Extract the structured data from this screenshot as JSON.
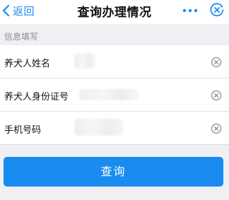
{
  "navbar": {
    "back_label": "返回",
    "title": "查询办理情况",
    "back_icon": "chevron-left-icon",
    "more_icon": "more-dots-icon",
    "close_icon": "close-circle-icon"
  },
  "section": {
    "header": "信息填写"
  },
  "form": {
    "fields": [
      {
        "label": "养犬人姓名",
        "value_state": "redacted",
        "clear_icon": "clear-icon"
      },
      {
        "label": "养犬人身份证号",
        "value_state": "redacted",
        "clear_icon": "clear-icon"
      },
      {
        "label": "手机号码",
        "value_state": "redacted",
        "clear_icon": "clear-icon"
      }
    ]
  },
  "submit": {
    "label": "查询"
  },
  "colors": {
    "accent": "#1a8cf0",
    "background": "#efeff4",
    "surface": "#ffffff"
  }
}
